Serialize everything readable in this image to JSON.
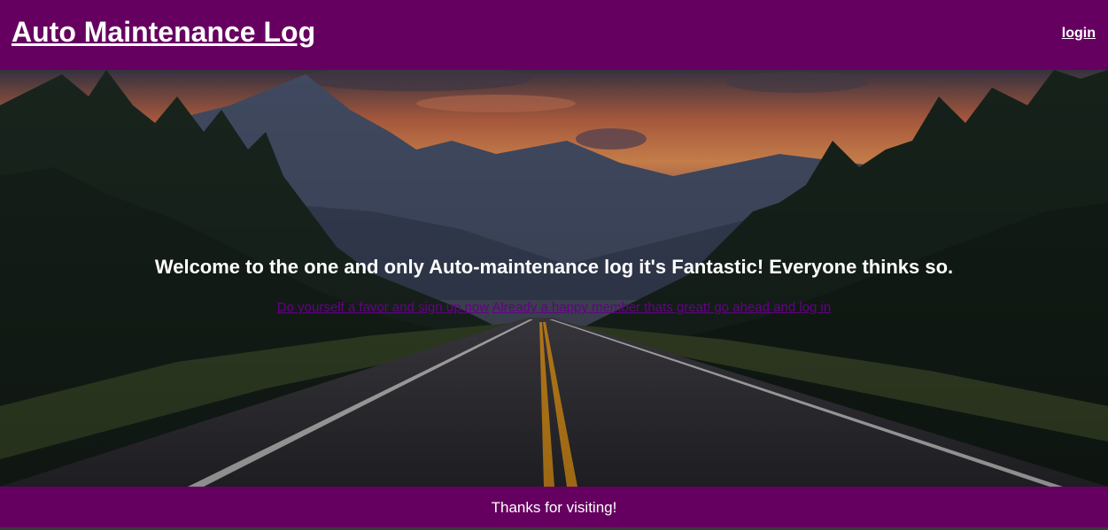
{
  "header": {
    "title": "Auto Maintenance Log",
    "login_label": "login"
  },
  "hero": {
    "headline": "Welcome to the one and only Auto-maintenance log it's Fantastic! Everyone thinks so.",
    "signup_link": "Do yourself a favor and sign up now",
    "login_link": "Already a happy member thats great! go ahead and log in"
  },
  "footer": {
    "text": "Thanks for visiting!"
  },
  "colors": {
    "header_bg": "#660060",
    "footer_bg": "#660060",
    "link_color": "#660088",
    "text_light": "#ffffff"
  }
}
